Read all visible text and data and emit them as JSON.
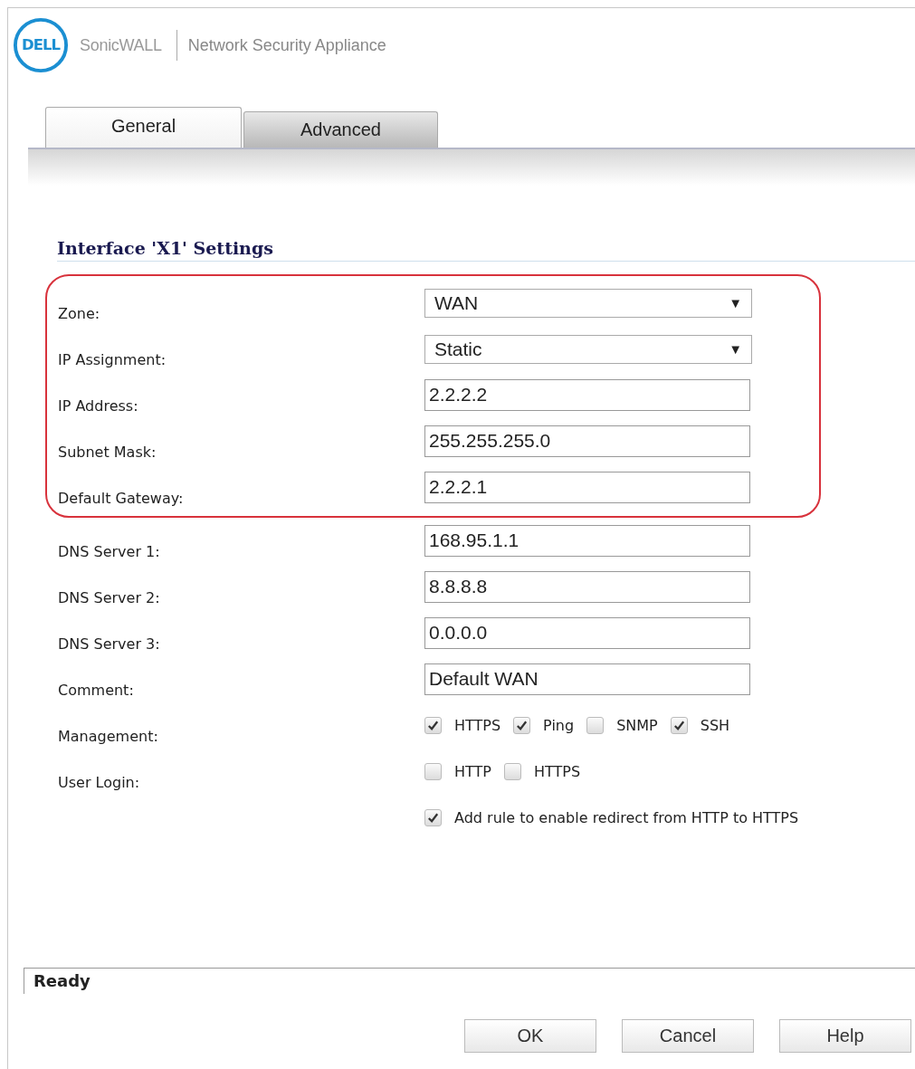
{
  "header": {
    "logo": "DELL",
    "brand": "SonicWALL",
    "product": "Network Security Appliance"
  },
  "tabs": [
    {
      "label": "General",
      "selected": true
    },
    {
      "label": "Advanced",
      "selected": false
    }
  ],
  "section_title": "Interface 'X1' Settings",
  "fields": [
    {
      "kind": "select",
      "label": "Zone:",
      "value": "WAN",
      "arrow": "▼",
      "highlighted": true
    },
    {
      "kind": "select",
      "label": "IP Assignment:",
      "value": "Static",
      "arrow": "▼",
      "highlighted": true
    },
    {
      "kind": "text",
      "label": "IP Address:",
      "value": "2.2.2.2",
      "highlighted": true
    },
    {
      "kind": "text",
      "label": "Subnet Mask:",
      "value": "255.255.255.0",
      "highlighted": true
    },
    {
      "kind": "text",
      "label": "Default Gateway:",
      "value": "2.2.2.1",
      "highlighted": true
    },
    {
      "kind": "text",
      "label": "DNS Server 1:",
      "value": "168.95.1.1",
      "highlighted": false
    },
    {
      "kind": "text",
      "label": "DNS Server 2:",
      "value": "8.8.8.8",
      "highlighted": false
    },
    {
      "kind": "text",
      "label": "DNS Server 3:",
      "value": "0.0.0.0",
      "highlighted": false
    },
    {
      "kind": "text",
      "label": "Comment:",
      "value": "Default WAN",
      "highlighted": false
    },
    {
      "kind": "checks",
      "label": "Management:",
      "options": [
        {
          "label": "HTTPS",
          "checked": true
        },
        {
          "label": "Ping",
          "checked": true
        },
        {
          "label": "SNMP",
          "checked": false
        },
        {
          "label": "SSH",
          "checked": true
        }
      ],
      "highlighted": false
    },
    {
      "kind": "checks",
      "label": "User Login:",
      "options": [
        {
          "label": "HTTP",
          "checked": false
        },
        {
          "label": "HTTPS",
          "checked": false
        }
      ],
      "highlighted": false
    },
    {
      "kind": "checks",
      "options": [
        {
          "label": "Add rule to enable redirect from HTTP to HTTPS",
          "checked": true
        }
      ],
      "highlighted": false
    }
  ],
  "status_bar": "Ready",
  "buttons": [
    "OK",
    "Cancel",
    "Help"
  ]
}
